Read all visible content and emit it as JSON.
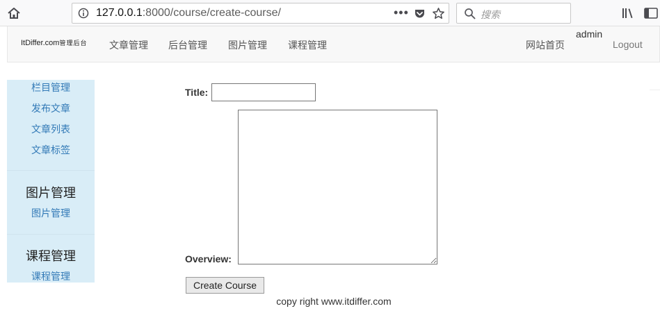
{
  "browser": {
    "url_host": "127.0.0.1",
    "url_rest": ":8000/course/create-course/",
    "url_actions": "•••",
    "search_placeholder": "搜索"
  },
  "navbar": {
    "brand_text": "ItDiffer.com",
    "brand_cn": "管理后台",
    "items": [
      "文章管理",
      "后台管理",
      "图片管理",
      "课程管理"
    ],
    "home_link": "网站首页",
    "user": "admin",
    "logout": "Logout"
  },
  "leftmenu": {
    "article_links": [
      "栏目管理",
      "发布文章",
      "文章列表",
      "文章标签"
    ],
    "image_heading": "图片管理",
    "image_link": "图片管理",
    "course_heading": "课程管理",
    "course_link": "课程管理"
  },
  "form": {
    "title_label": "Title:",
    "title_value": "",
    "overview_label": "Overview:",
    "overview_value": "",
    "submit_label": "Create Course"
  },
  "footer": {
    "copyright": "copy right www.itdiffer.com"
  }
}
